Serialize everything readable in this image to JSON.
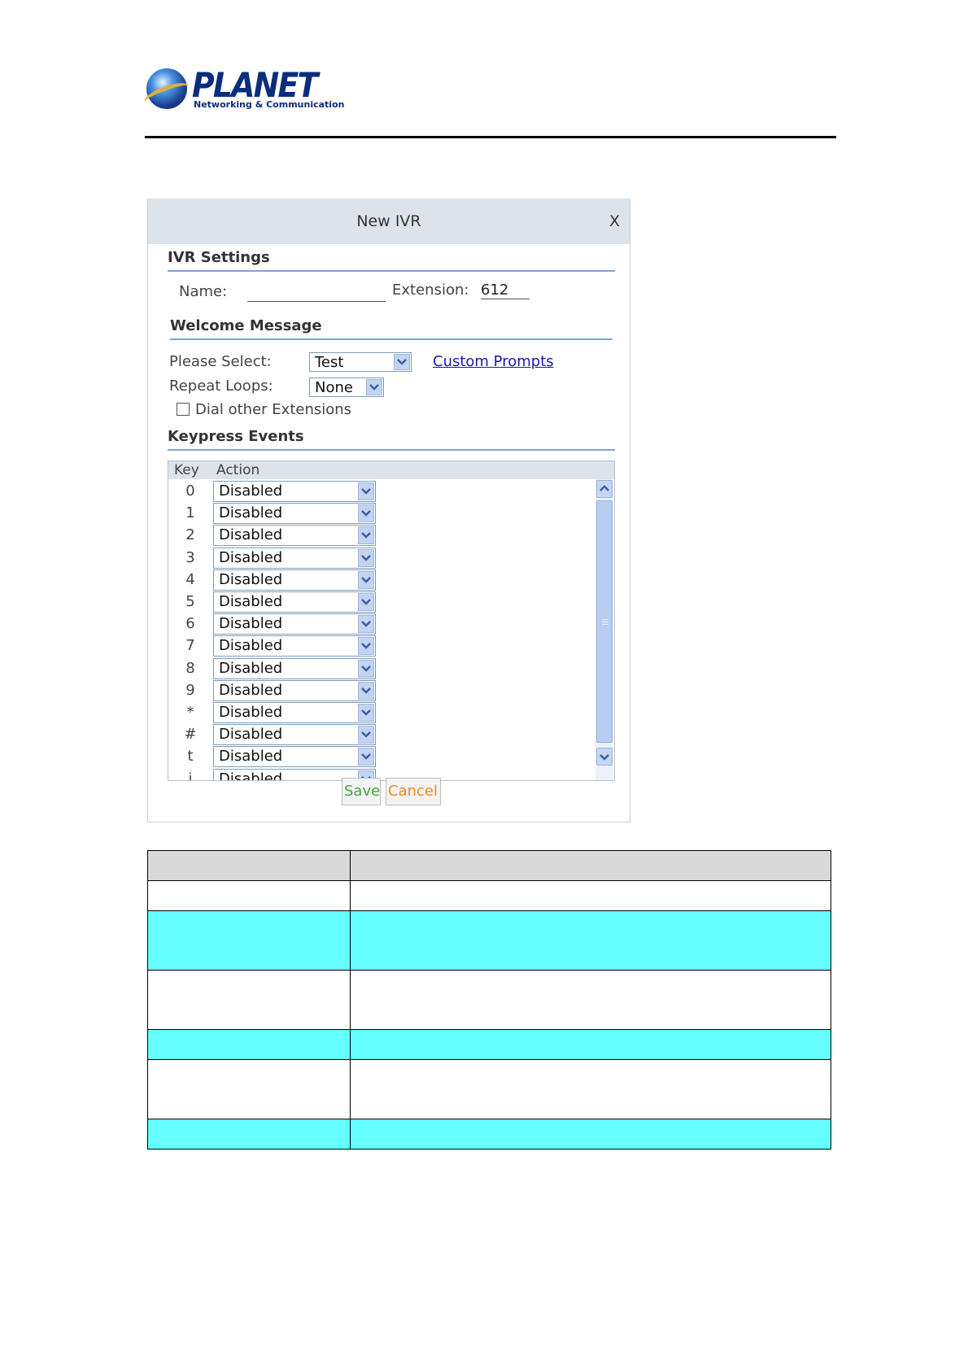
{
  "brand": {
    "name": "PLANET",
    "tagline": "Networking & Communication"
  },
  "dialog": {
    "title": "New IVR",
    "close_label": "X",
    "ivr_settings": {
      "heading": "IVR Settings",
      "name_label": "Name:",
      "name_value": "",
      "extension_label": "Extension:",
      "extension_value": "612"
    },
    "welcome": {
      "heading": "Welcome Message",
      "select_label": "Please Select:",
      "select_value": "Test",
      "custom_prompts_link": "Custom Prompts",
      "repeat_label": "Repeat Loops:",
      "repeat_value": "None",
      "dial_other_label": "Dial other Extensions",
      "dial_other_checked": false
    },
    "keypress": {
      "heading": "Keypress Events",
      "col_key": "Key",
      "col_action": "Action",
      "rows": [
        {
          "key": "0",
          "action": "Disabled"
        },
        {
          "key": "1",
          "action": "Disabled"
        },
        {
          "key": "2",
          "action": "Disabled"
        },
        {
          "key": "3",
          "action": "Disabled"
        },
        {
          "key": "4",
          "action": "Disabled"
        },
        {
          "key": "5",
          "action": "Disabled"
        },
        {
          "key": "6",
          "action": "Disabled"
        },
        {
          "key": "7",
          "action": "Disabled"
        },
        {
          "key": "8",
          "action": "Disabled"
        },
        {
          "key": "9",
          "action": "Disabled"
        },
        {
          "key": "*",
          "action": "Disabled"
        },
        {
          "key": "#",
          "action": "Disabled"
        },
        {
          "key": "t",
          "action": "Disabled"
        },
        {
          "key": "i",
          "action": "Disabled"
        }
      ]
    },
    "save_label": "Save",
    "cancel_label": "Cancel"
  },
  "table_row_colors": [
    "header-grey",
    "white",
    "cyan",
    "white",
    "cyan",
    "white",
    "cyan"
  ],
  "colors": {
    "cyan": "#66ffff",
    "header_grey": "#d9d9d9",
    "link_blue": "#1a1aa6",
    "save_green": "#3da83d",
    "cancel_orange": "#f08a1e"
  }
}
